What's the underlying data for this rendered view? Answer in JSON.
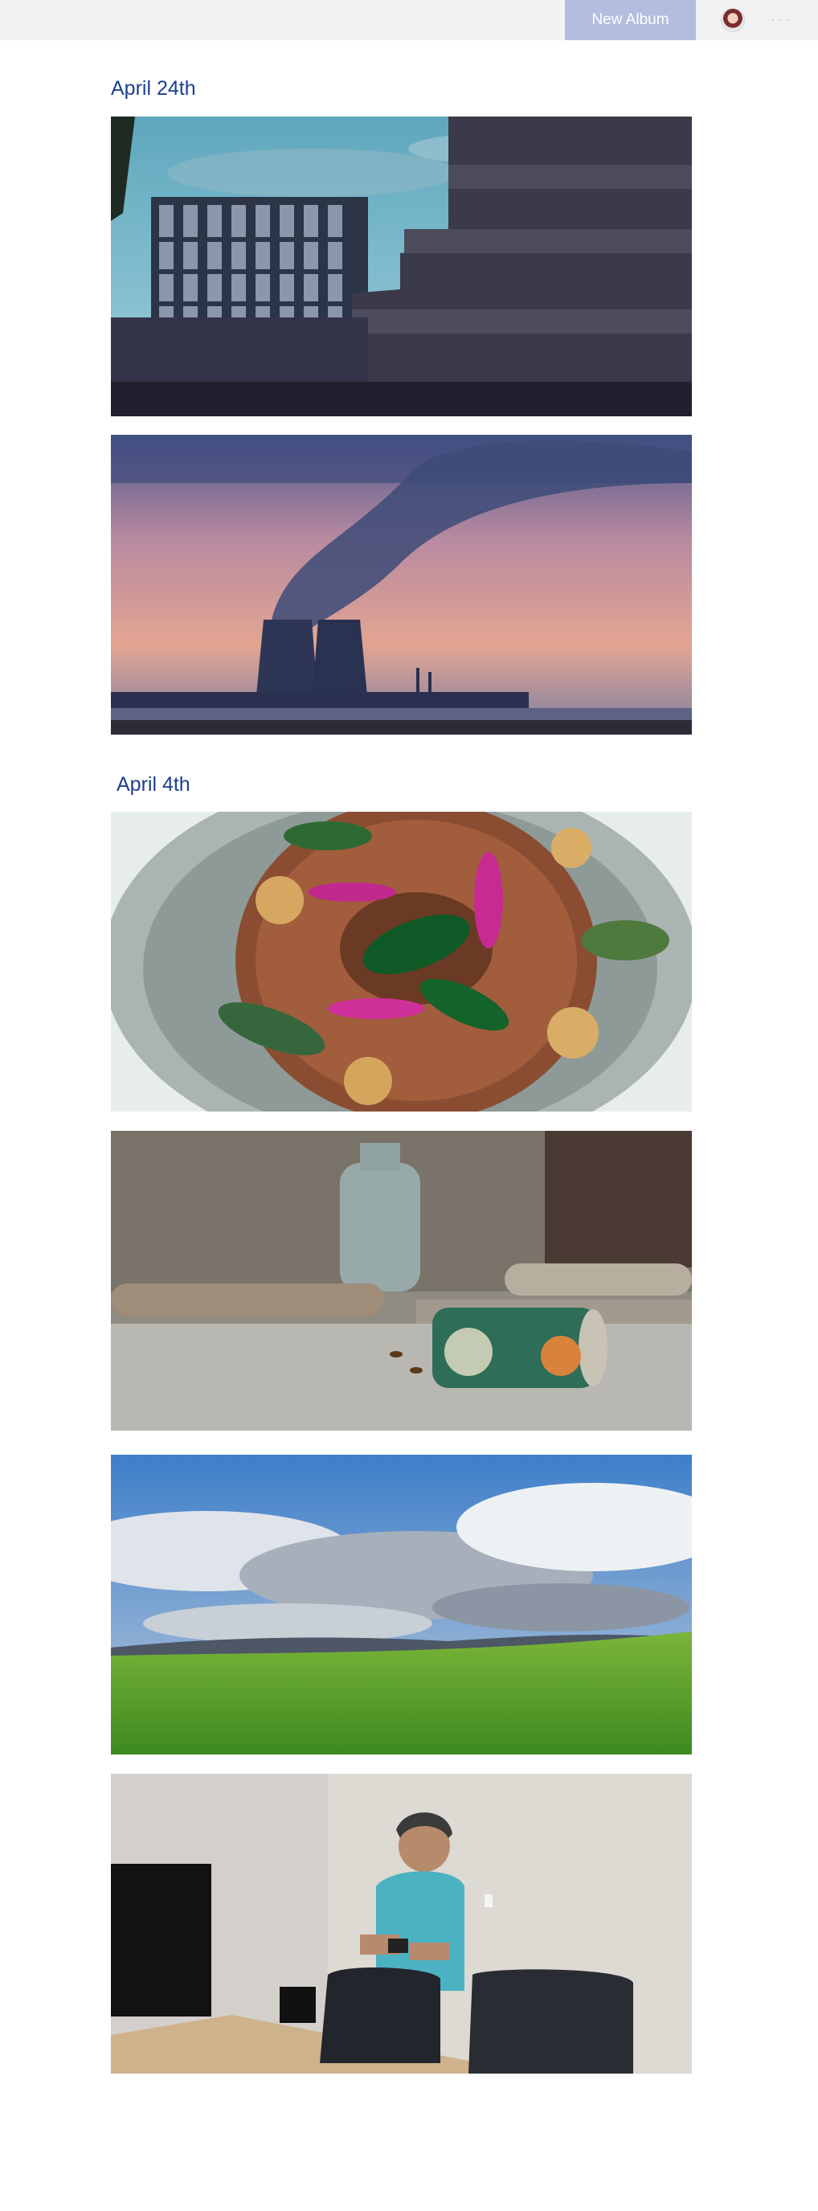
{
  "header": {
    "new_album_label": "New Album",
    "avatar_icon": "user-avatar-icon",
    "more_icon": "ellipsis-icon",
    "accent_color": "#b3bede"
  },
  "groups": [
    {
      "date": "April 24th",
      "photos": [
        {
          "subject": "modernist concrete buildings under blue sky"
        },
        {
          "subject": "cooling towers emitting smoke at sunset"
        }
      ]
    },
    {
      "date": "April 4th",
      "photos": [
        {
          "subject": "round bread loaf with walnuts and flowers"
        },
        {
          "subject": "crushed can on concrete with bees"
        },
        {
          "subject": "green field under cloudy sky"
        },
        {
          "subject": "man looking at phone in conference room"
        }
      ]
    }
  ],
  "colors": {
    "heading": "#1d3f8f",
    "topbar_bg": "#f2f2f2"
  }
}
